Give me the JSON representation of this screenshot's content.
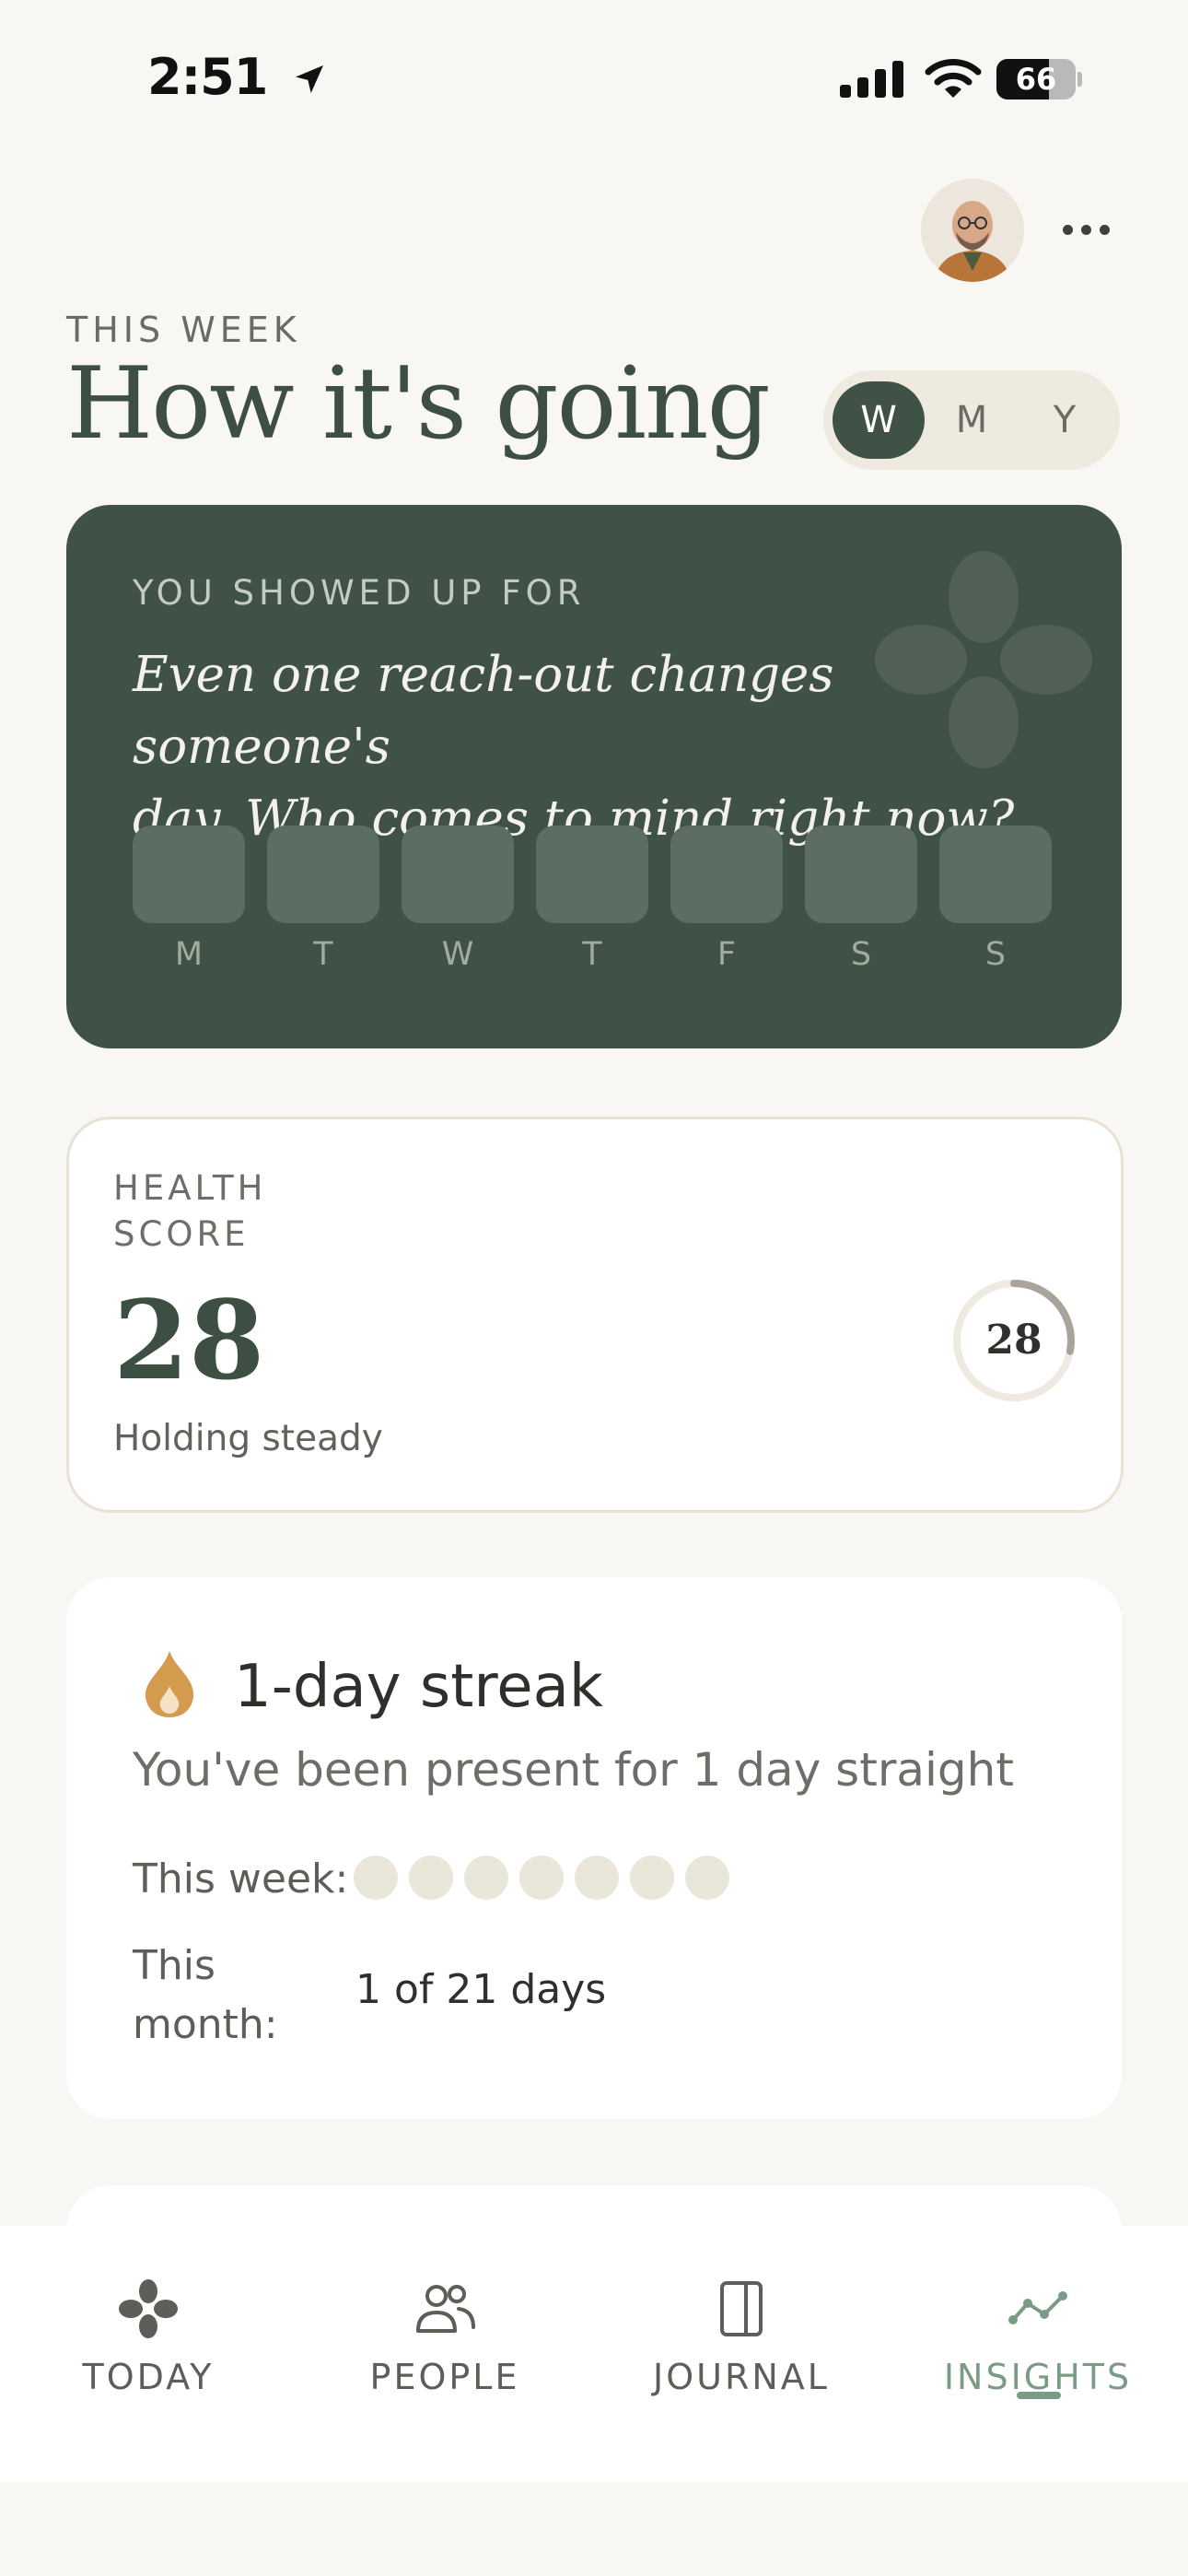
{
  "status_bar": {
    "time": "2:51",
    "battery": "66",
    "battery_level": 0.66
  },
  "header": {
    "eyebrow": "THIS WEEK",
    "title": "How it's going",
    "period_options": [
      "W",
      "M",
      "Y"
    ],
    "period_selected": "W"
  },
  "showed_up": {
    "label": "YOU SHOWED UP FOR",
    "quote_line1": "Even one reach-out changes someone's",
    "quote_line2": "day. Who comes to mind right now?",
    "days": [
      "M",
      "T",
      "W",
      "T",
      "F",
      "S",
      "S"
    ]
  },
  "health": {
    "label": "HEALTH SCORE",
    "score": "28",
    "status": "Holding steady",
    "ring_value": "28",
    "ring_fraction": 0.28
  },
  "streak": {
    "title": "1-day streak",
    "subtitle": "You've been present for 1 day straight",
    "week_label": "This week:",
    "week_dots_filled": 0,
    "month_label": "This month:",
    "month_value": "1 of 21 days"
  },
  "tabs": [
    {
      "label": "TODAY",
      "icon": "clover-icon"
    },
    {
      "label": "PEOPLE",
      "icon": "people-icon"
    },
    {
      "label": "JOURNAL",
      "icon": "journal-icon"
    },
    {
      "label": "INSIGHTS",
      "icon": "insights-chart-icon"
    }
  ],
  "active_tab": "INSIGHTS",
  "colors": {
    "accent_green": "#3f5245",
    "card_green": "#405145",
    "active_tab": "#7a9c86",
    "streak_flame": "#d49a4e",
    "background": "#f8f7f4"
  }
}
